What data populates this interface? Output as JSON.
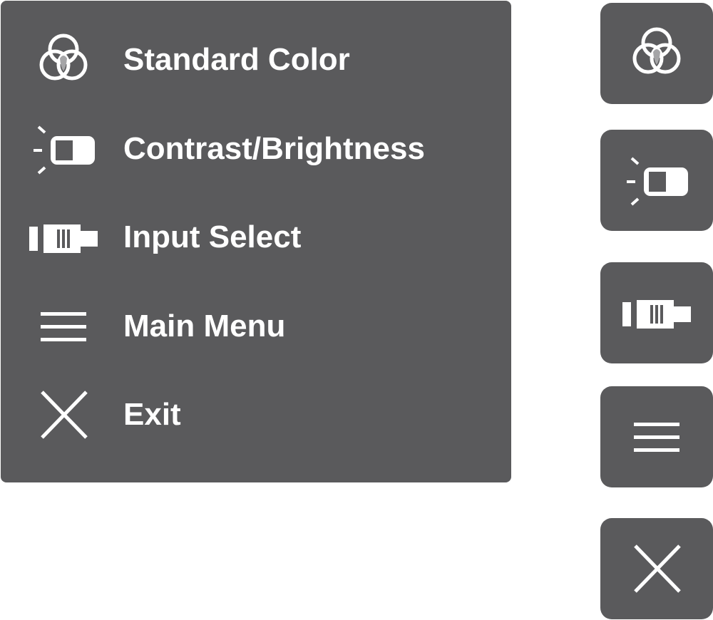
{
  "menu": {
    "items": [
      {
        "label": "Standard Color",
        "icon": "color-circles-icon"
      },
      {
        "label": "Contrast/Brightness",
        "icon": "contrast-brightness-icon"
      },
      {
        "label": "Input Select",
        "icon": "input-connector-icon"
      },
      {
        "label": "Main Menu",
        "icon": "hamburger-menu-icon"
      },
      {
        "label": "Exit",
        "icon": "close-icon"
      }
    ]
  },
  "quick_buttons": [
    {
      "icon": "color-circles-icon"
    },
    {
      "icon": "contrast-brightness-icon"
    },
    {
      "icon": "input-connector-icon"
    },
    {
      "icon": "hamburger-menu-icon"
    },
    {
      "icon": "close-icon"
    }
  ],
  "colors": {
    "panel_background": "#5a5a5c",
    "foreground": "#ffffff",
    "icon_overlap": "#a5a5a7"
  }
}
